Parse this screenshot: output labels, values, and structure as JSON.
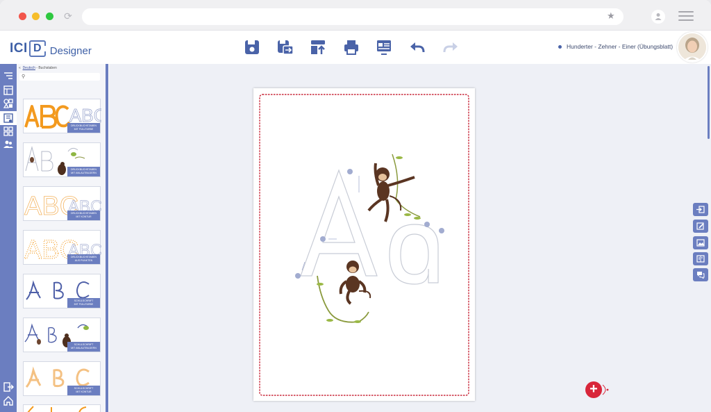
{
  "app": {
    "logo_ici": "ICI",
    "logo_d": "D",
    "logo_designer": "Designer"
  },
  "toolbar": {
    "tools": [
      "save-icon",
      "save-as-icon",
      "export-icon",
      "print-icon",
      "preview-icon",
      "undo-icon",
      "redo-icon"
    ]
  },
  "document": {
    "title": "Hunderter - Zehner - Einer (Übungsblatt)"
  },
  "panel": {
    "breadcrumb_link": "Deutsch",
    "breadcrumb_rest": " - Buchstaben",
    "search_placeholder": "",
    "cards": [
      {
        "line1": "Druckbuchstaben",
        "line2": "mit Füllfarbe"
      },
      {
        "line1": "Druckbuchstaben",
        "line2": "mit Anlautbildern"
      },
      {
        "line1": "Druckbuchstaben",
        "line2": "mit Kontur"
      },
      {
        "line1": "Druckbuchstaben",
        "line2": "aus Punkten"
      },
      {
        "line1": "Schulschrift",
        "line2": "mit Füllfarbe"
      },
      {
        "line1": "Schulschrift",
        "line2": "mit Anlautbildern"
      },
      {
        "line1": "Schulschrift",
        "line2": "mit Kontur"
      }
    ]
  },
  "colors": {
    "accent": "#6b7ec0",
    "brand": "#3d5fa6",
    "fab": "#d8263a",
    "page_border": "#c8283a"
  }
}
